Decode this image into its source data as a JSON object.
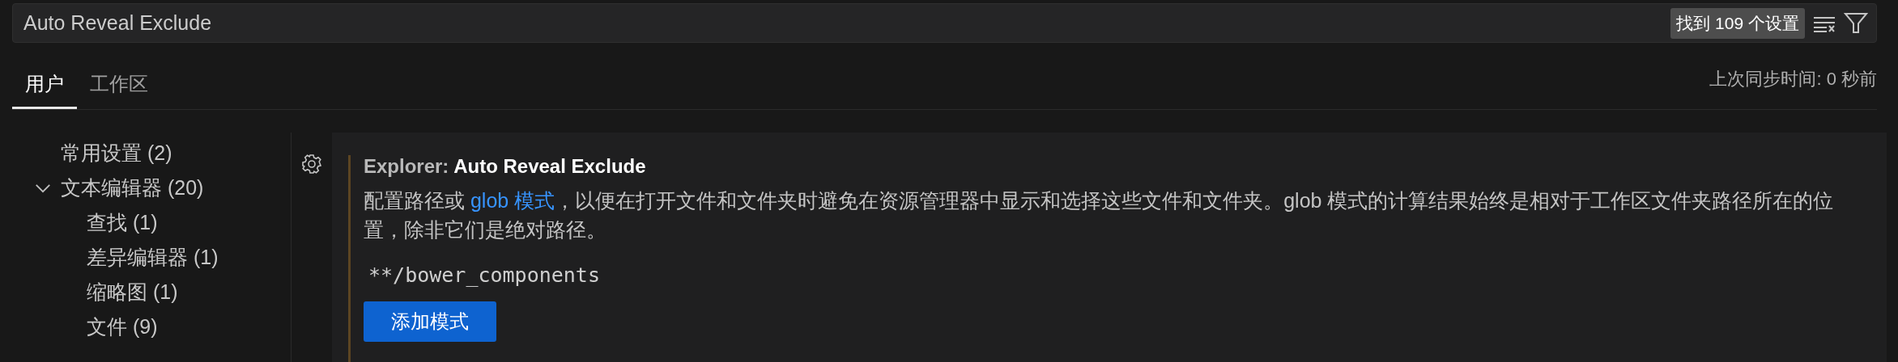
{
  "search": {
    "value": "Auto Reveal Exclude",
    "result_count": "找到 109 个设置"
  },
  "tabs": [
    {
      "label": "用户",
      "selected": true
    },
    {
      "label": "工作区",
      "selected": false
    }
  ],
  "sync_status": "上次同步时间: 0 秒前",
  "tree": [
    {
      "label": "常用设置 (2)"
    },
    {
      "label": "文本编辑器 (20)",
      "expanded": true,
      "children": [
        {
          "label": "查找 (1)"
        },
        {
          "label": "差异编辑器 (1)"
        },
        {
          "label": "缩略图 (1)"
        },
        {
          "label": "文件 (9)"
        }
      ]
    }
  ],
  "setting": {
    "category": "Explorer: ",
    "title": "Auto Reveal Exclude",
    "description_before": "配置路径或 ",
    "description_link": "glob 模式",
    "description_after": "，以便在打开文件和文件夹时避免在资源管理器中显示和选择这些文件和文件夹。glob 模式的计算结果始终是相对于工作区文件夹路径所在的位置，除非它们是绝对路径。",
    "items": [
      "**/bower_components"
    ],
    "add_button": "添加模式"
  }
}
